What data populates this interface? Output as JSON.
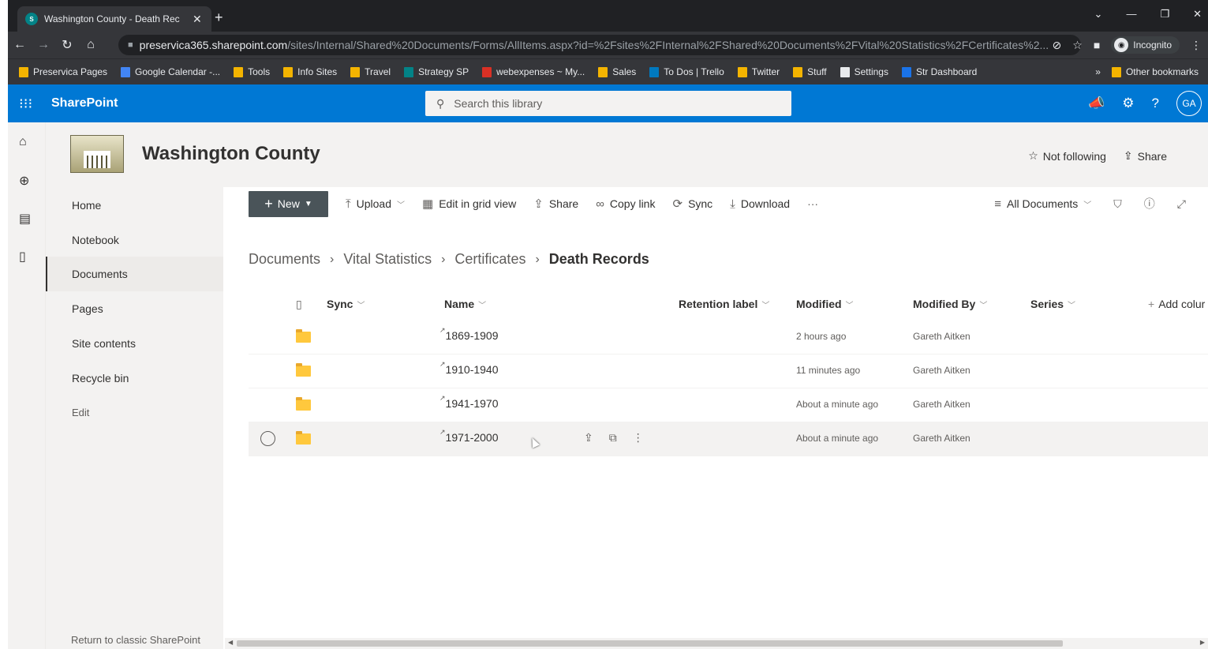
{
  "browser": {
    "tab_title": "Washington County - Death Rec",
    "tab_favicon": "S",
    "new_tab": "+",
    "url_host": "preservica365.sharepoint.com",
    "url_path": "/sites/Internal/Shared%20Documents/Forms/AllItems.aspx?id=%2Fsites%2FInternal%2FShared%20Documents%2FVital%20Statistics%2FCertificates%2...",
    "incognito_label": "Incognito",
    "bookmarks": [
      {
        "label": "Preservica Pages",
        "color": "#f4b400"
      },
      {
        "label": "Google Calendar -...",
        "color": "#4285f4"
      },
      {
        "label": "Tools",
        "color": "#f4b400"
      },
      {
        "label": "Info Sites",
        "color": "#f4b400"
      },
      {
        "label": "Travel",
        "color": "#f4b400"
      },
      {
        "label": "Strategy SP",
        "color": "#038387"
      },
      {
        "label": "webexpenses ~ My...",
        "color": "#d93025"
      },
      {
        "label": "Sales",
        "color": "#f4b400"
      },
      {
        "label": "To Dos | Trello",
        "color": "#0079bf"
      },
      {
        "label": "Twitter",
        "color": "#f4b400"
      },
      {
        "label": "Stuff",
        "color": "#f4b400"
      },
      {
        "label": "Settings",
        "color": "#e8eaed"
      },
      {
        "label": "Str Dashboard",
        "color": "#1a73e8"
      }
    ],
    "other_bookmarks": "Other bookmarks",
    "more_bookmarks": "»"
  },
  "suite": {
    "brand": "SharePoint",
    "search_placeholder": "Search this library",
    "avatar_initials": "GA",
    "accent": "#0078d4"
  },
  "site": {
    "title": "Washington County",
    "follow_label": "Not following",
    "share_label": "Share"
  },
  "nav": {
    "items": [
      "Home",
      "Notebook",
      "Documents",
      "Pages",
      "Site contents",
      "Recycle bin",
      "Edit"
    ],
    "selected": "Documents",
    "classic_link": "Return to classic SharePoint"
  },
  "commands": {
    "new": "New",
    "upload": "Upload",
    "grid": "Edit in grid view",
    "share": "Share",
    "copy_link": "Copy link",
    "sync": "Sync",
    "download": "Download",
    "more": "···",
    "view": "All Documents"
  },
  "breadcrumb": [
    "Documents",
    "Vital Statistics",
    "Certificates",
    "Death Records"
  ],
  "columns": {
    "sync": "Sync",
    "name": "Name",
    "retention": "Retention label",
    "modified": "Modified",
    "modified_by": "Modified By",
    "series": "Series",
    "add_column": "Add colur"
  },
  "rows": [
    {
      "name": "1869-1909",
      "modified": "2 hours ago",
      "modified_by": "Gareth Aitken"
    },
    {
      "name": "1910-1940",
      "modified": "11 minutes ago",
      "modified_by": "Gareth Aitken"
    },
    {
      "name": "1941-1970",
      "modified": "About a minute ago",
      "modified_by": "Gareth Aitken"
    },
    {
      "name": "1971-2000",
      "modified": "About a minute ago",
      "modified_by": "Gareth Aitken"
    }
  ]
}
